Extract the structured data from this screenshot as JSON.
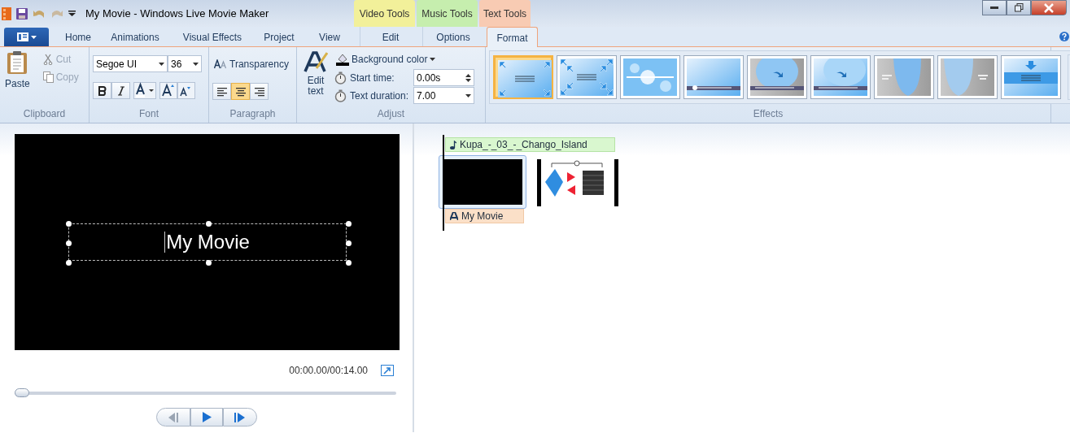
{
  "window": {
    "title": "My Movie - Windows Live Movie Maker",
    "context_groups": [
      {
        "label": "Video Tools",
        "color": "#f2f09a"
      },
      {
        "label": "Music Tools",
        "color": "#c6eeae"
      },
      {
        "label": "Text Tools",
        "color": "#f8cbb3"
      }
    ]
  },
  "tabs": [
    {
      "label": "Home",
      "selected": false
    },
    {
      "label": "Animations",
      "selected": false
    },
    {
      "label": "Visual Effects",
      "selected": false
    },
    {
      "label": "Project",
      "selected": false
    },
    {
      "label": "View",
      "selected": false
    },
    {
      "label": "Edit",
      "selected": false
    },
    {
      "label": "Options",
      "selected": false
    },
    {
      "label": "Format",
      "selected": true
    }
  ],
  "ribbon": {
    "clipboard": {
      "label": "Clipboard",
      "paste": {
        "label": "Paste",
        "disabled": false
      },
      "cut": {
        "label": "Cut",
        "disabled": true
      },
      "copy": {
        "label": "Copy",
        "disabled": true
      }
    },
    "font": {
      "label": "Font",
      "family": "Segoe UI",
      "size": "36",
      "bold": false,
      "italic": false
    },
    "paragraph": {
      "label": "Paragraph",
      "transparency": "Transparency",
      "alignments": [
        {
          "kind": "left",
          "selected": false
        },
        {
          "kind": "center",
          "selected": true
        },
        {
          "kind": "right",
          "selected": false
        }
      ]
    },
    "adjust": {
      "label": "Adjust",
      "edit_text": "Edit text",
      "background_color": "Background color",
      "start_time_label": "Start time:",
      "start_time": "0.00s",
      "duration_label": "Text duration:",
      "duration": "7.00"
    },
    "effects": {
      "label": "Effects",
      "items": [
        {
          "kind": "zoom",
          "selected": true
        },
        {
          "kind": "zoom-double",
          "selected": false
        },
        {
          "kind": "burst",
          "selected": false
        },
        {
          "kind": "streak",
          "selected": false
        },
        {
          "kind": "swoosh-grey",
          "selected": false
        },
        {
          "kind": "swoosh-blue",
          "selected": false
        },
        {
          "kind": "curtain-left",
          "selected": false
        },
        {
          "kind": "curtain-right",
          "selected": false
        },
        {
          "kind": "drop",
          "selected": false
        }
      ]
    }
  },
  "preview": {
    "caption": "My Movie",
    "time": "00:00.00/00:14.00",
    "seek": {
      "level": 0
    }
  },
  "storyboard": {
    "audio": "Kupa_-_03_-_Chango_Island",
    "clips": [
      {
        "kind": "black",
        "selected": true
      },
      {
        "kind": "picture",
        "selected": false
      }
    ],
    "caption": "My Movie"
  }
}
